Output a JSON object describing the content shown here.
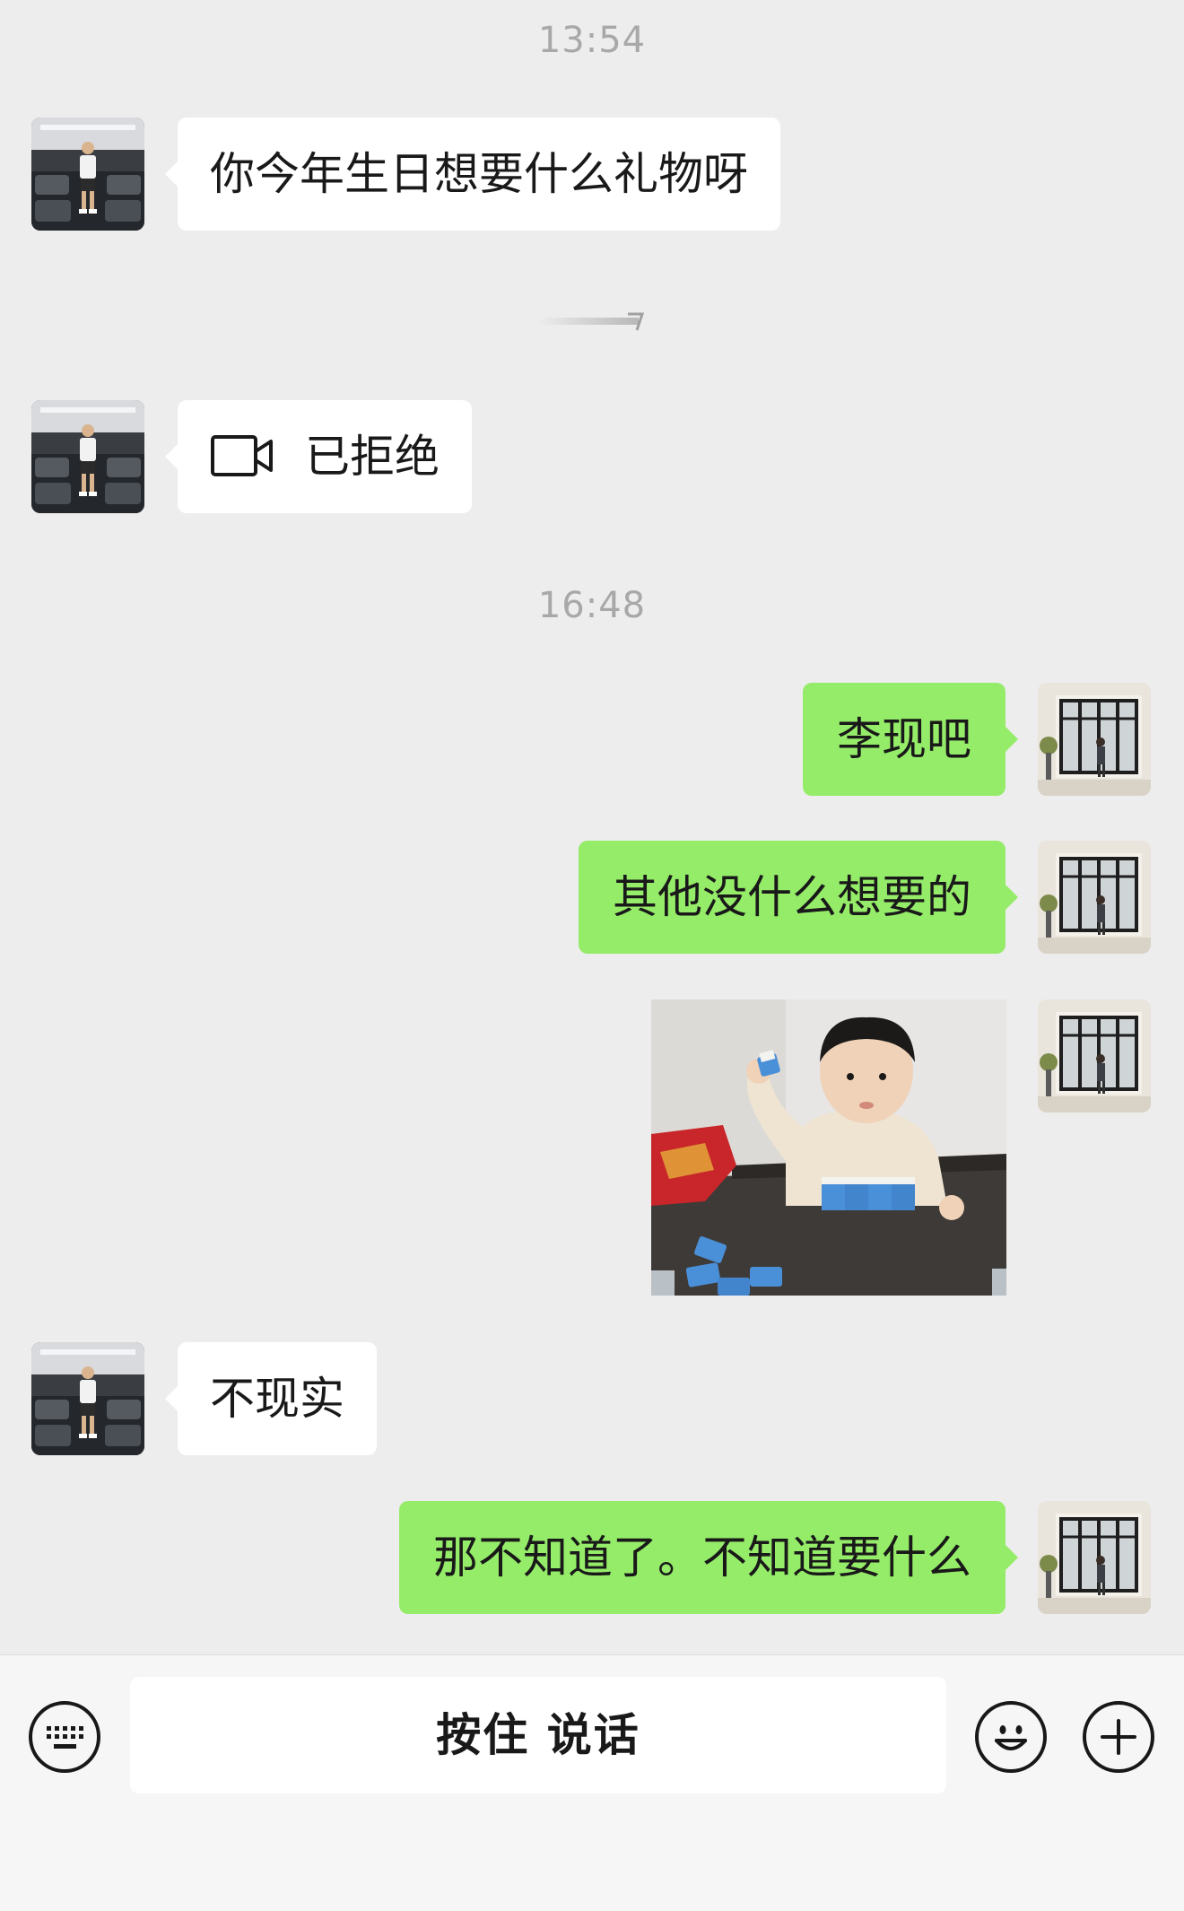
{
  "timestamps": [
    "13:54",
    "16:48"
  ],
  "messages": {
    "m1": "你今年生日想要什么礼物呀",
    "m2_call": "已拒绝",
    "m3": "李现吧",
    "m4": "其他没什么想要的",
    "m6": "不现实",
    "m7": "那不知道了。不知道要什么"
  },
  "input": {
    "voice_label": "按住 说话"
  },
  "icons": {
    "call": "video-call-icon",
    "keyboard": "keyboard-icon",
    "emoji": "emoji-icon",
    "plus": "plus-icon"
  },
  "colors": {
    "background": "#ededed",
    "outgoing_bubble": "#95ec69",
    "incoming_bubble": "#ffffff",
    "timestamp": "#a8a8a8"
  }
}
